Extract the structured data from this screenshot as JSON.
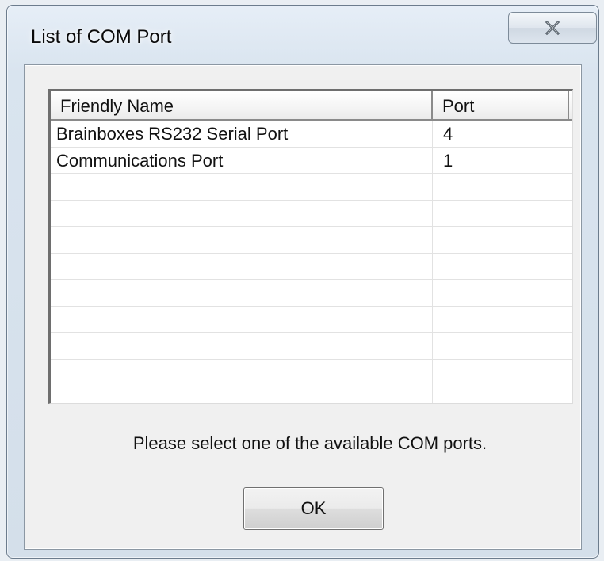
{
  "window": {
    "title": "List of COM Port",
    "close_icon": "close-icon"
  },
  "list": {
    "columns": [
      {
        "label": "Friendly Name"
      },
      {
        "label": "Port"
      }
    ],
    "rows": [
      {
        "name": "Brainboxes RS232 Serial Port",
        "port": "4"
      },
      {
        "name": "Communications Port",
        "port": "1"
      },
      {
        "name": "",
        "port": ""
      },
      {
        "name": "",
        "port": ""
      },
      {
        "name": "",
        "port": ""
      },
      {
        "name": "",
        "port": ""
      },
      {
        "name": "",
        "port": ""
      },
      {
        "name": "",
        "port": ""
      },
      {
        "name": "",
        "port": ""
      },
      {
        "name": "",
        "port": ""
      },
      {
        "name": "",
        "port": ""
      }
    ]
  },
  "message": "Please select one of the available COM ports.",
  "ok_label": "OK"
}
